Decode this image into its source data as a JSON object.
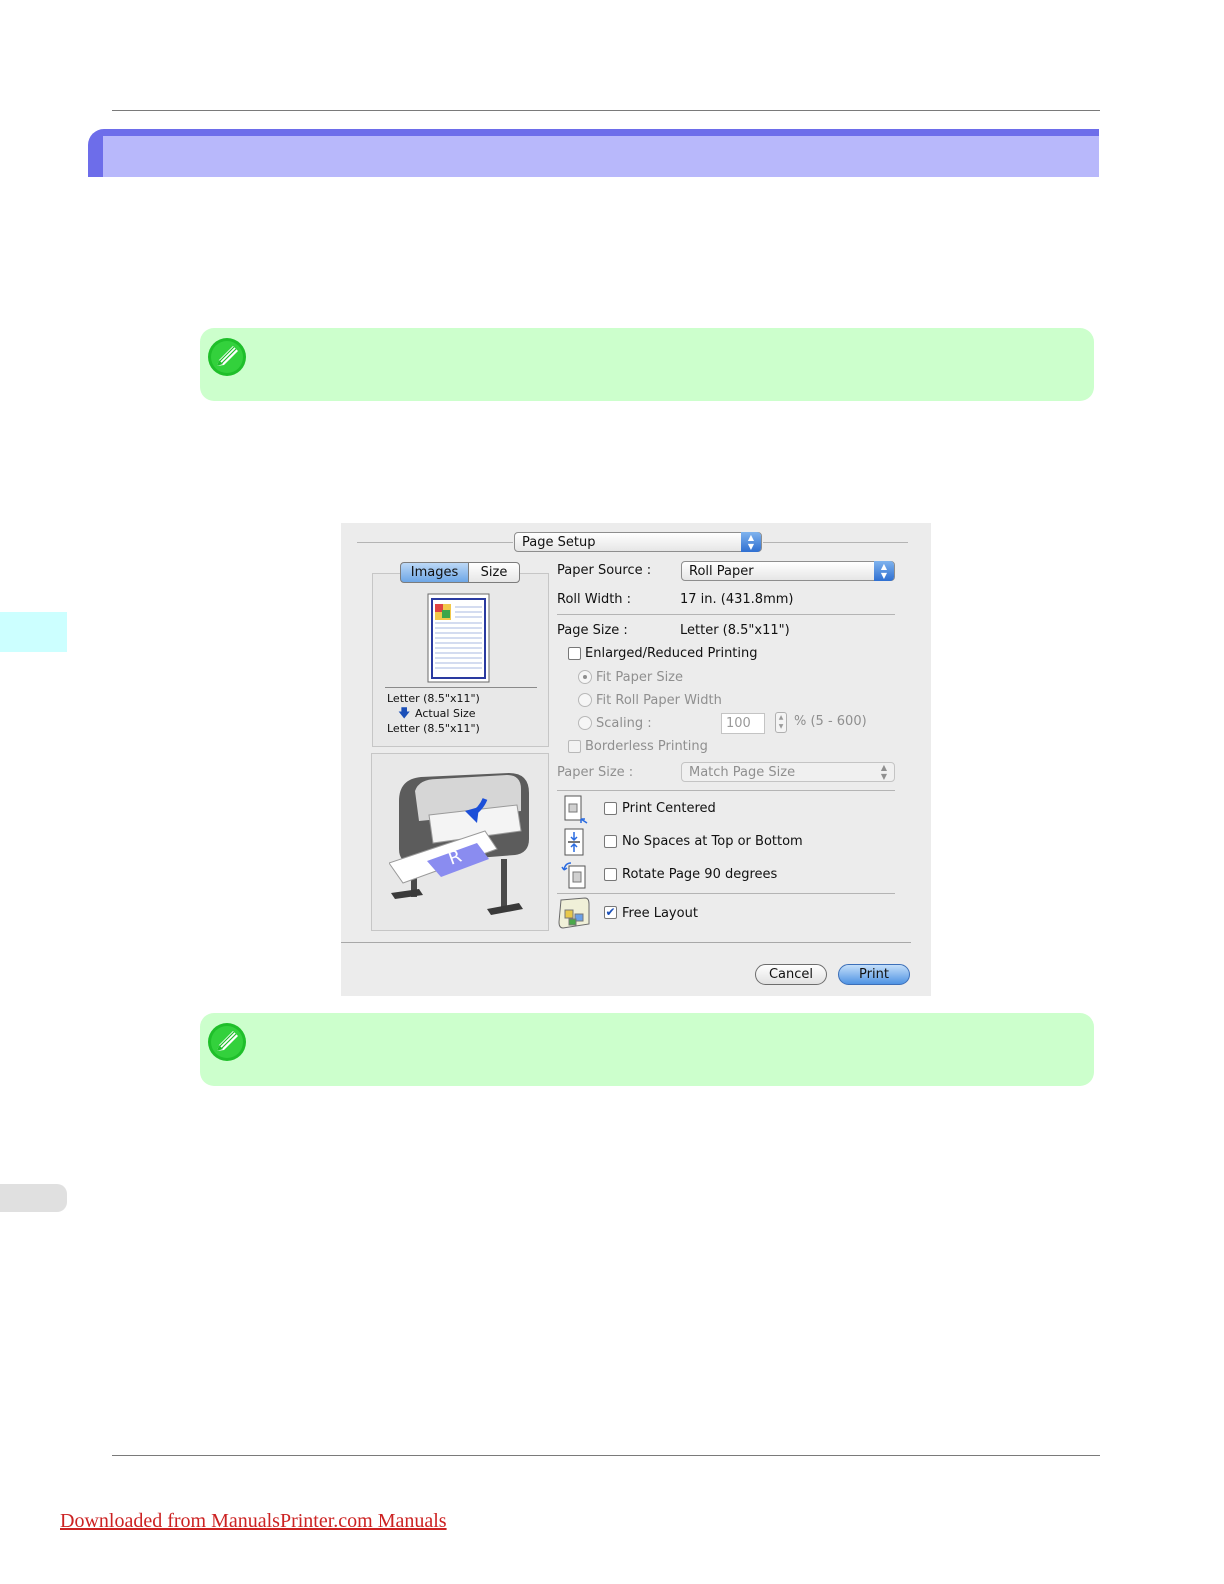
{
  "dialog": {
    "panel_popup": "Page Setup",
    "view_tabs": [
      {
        "label": "Images",
        "selected": true
      },
      {
        "label": "Size",
        "selected": false
      }
    ],
    "preview": {
      "from_size": "Letter (8.5\"x11\")",
      "scale_label": "Actual Size",
      "to_size": "Letter (8.5\"x11\")"
    },
    "paper_source": {
      "label": "Paper Source :",
      "value": "Roll Paper"
    },
    "roll_width": {
      "label": "Roll Width :",
      "value": "17 in. (431.8mm)"
    },
    "page_size": {
      "label": "Page Size :",
      "value": "Letter (8.5\"x11\")"
    },
    "enlarged_reduced": {
      "label": "Enlarged/Reduced Printing",
      "checked": false
    },
    "fit_paper_size": {
      "label": "Fit Paper Size",
      "selected": true,
      "enabled": false
    },
    "fit_roll_width": {
      "label": "Fit Roll Paper Width",
      "selected": false,
      "enabled": false
    },
    "scaling": {
      "label": "Scaling :",
      "value": "100",
      "range": "% (5 - 600)",
      "enabled": false
    },
    "borderless": {
      "label": "Borderless Printing",
      "checked": false,
      "enabled": false
    },
    "paper_size": {
      "label": "Paper Size :",
      "value": "Match Page Size",
      "enabled": false
    },
    "print_centered": {
      "label": "Print Centered",
      "checked": false
    },
    "no_spaces": {
      "label": "No Spaces at Top or Bottom",
      "checked": false
    },
    "rotate_page": {
      "label": "Rotate Page 90 degrees",
      "checked": false
    },
    "free_layout": {
      "label": "Free Layout",
      "checked": true
    },
    "cancel_label": "Cancel",
    "print_label": "Print"
  },
  "footer": {
    "link_text": "Downloaded from ManualsPrinter.com Manuals"
  },
  "colors": {
    "section_bar": "#b8b8fb",
    "section_bar_accent": "#6d6dea",
    "note_background": "#ccffcc",
    "side_tab": "#ccffff",
    "footer_link": "#cc2222"
  }
}
